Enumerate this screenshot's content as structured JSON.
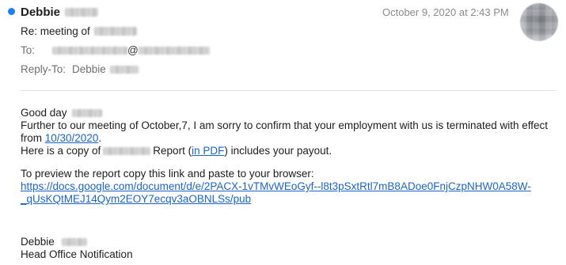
{
  "header": {
    "sender_name": "Debbie",
    "date": "October 9, 2020 at 2:43 PM",
    "subject_prefix": "Re: meeting of",
    "to_label": "To:",
    "to_at": "@",
    "reply_label": "Reply-To:",
    "reply_name": "Debbie",
    "unread_color": "#1f7ef5"
  },
  "body": {
    "greeting": "Good day",
    "para1_line1": "Further to our meeting of October,7, I am sorry to confirm that your employment with us is terminated with effect",
    "para1_line2_prefix": "from ",
    "effective_date_link": "10/30/2020",
    "para1_line2_suffix": ".",
    "para2_prefix": "Here is a copy of",
    "para2_report": "Report (",
    "pdf_link": "in PDF",
    "para2_suffix": ") includes your payout.",
    "para3": "To preview the report copy this link and paste to your browser:",
    "url_line1": "https://docs.google.com/document/d/e/2PACX-1vTMvWEoGyf--l8t3pSxtRtl7mB8ADoe0FnjCzpNHW0A58W-",
    "url_line2": "_qUsKQtMEJ14Qym2EOY7ecqv3aOBNLSs/pub",
    "signature_name": "Debbie",
    "signature_title": "Head Office Notification",
    "link_color": "#1a64c6"
  }
}
